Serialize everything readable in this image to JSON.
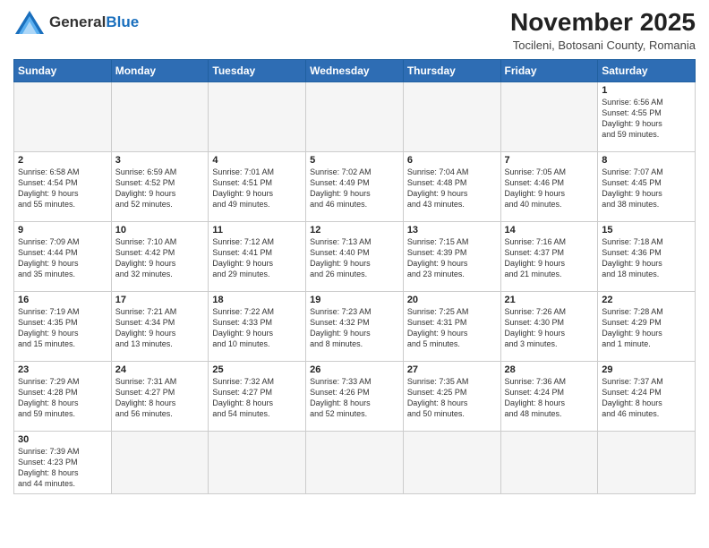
{
  "header": {
    "logo_general": "General",
    "logo_blue": "Blue",
    "month_title": "November 2025",
    "location": "Tocileni, Botosani County, Romania"
  },
  "weekdays": [
    "Sunday",
    "Monday",
    "Tuesday",
    "Wednesday",
    "Thursday",
    "Friday",
    "Saturday"
  ],
  "weeks": [
    [
      {
        "day": "",
        "info": ""
      },
      {
        "day": "",
        "info": ""
      },
      {
        "day": "",
        "info": ""
      },
      {
        "day": "",
        "info": ""
      },
      {
        "day": "",
        "info": ""
      },
      {
        "day": "",
        "info": ""
      },
      {
        "day": "1",
        "info": "Sunrise: 6:56 AM\nSunset: 4:55 PM\nDaylight: 9 hours\nand 59 minutes."
      }
    ],
    [
      {
        "day": "2",
        "info": "Sunrise: 6:58 AM\nSunset: 4:54 PM\nDaylight: 9 hours\nand 55 minutes."
      },
      {
        "day": "3",
        "info": "Sunrise: 6:59 AM\nSunset: 4:52 PM\nDaylight: 9 hours\nand 52 minutes."
      },
      {
        "day": "4",
        "info": "Sunrise: 7:01 AM\nSunset: 4:51 PM\nDaylight: 9 hours\nand 49 minutes."
      },
      {
        "day": "5",
        "info": "Sunrise: 7:02 AM\nSunset: 4:49 PM\nDaylight: 9 hours\nand 46 minutes."
      },
      {
        "day": "6",
        "info": "Sunrise: 7:04 AM\nSunset: 4:48 PM\nDaylight: 9 hours\nand 43 minutes."
      },
      {
        "day": "7",
        "info": "Sunrise: 7:05 AM\nSunset: 4:46 PM\nDaylight: 9 hours\nand 40 minutes."
      },
      {
        "day": "8",
        "info": "Sunrise: 7:07 AM\nSunset: 4:45 PM\nDaylight: 9 hours\nand 38 minutes."
      }
    ],
    [
      {
        "day": "9",
        "info": "Sunrise: 7:09 AM\nSunset: 4:44 PM\nDaylight: 9 hours\nand 35 minutes."
      },
      {
        "day": "10",
        "info": "Sunrise: 7:10 AM\nSunset: 4:42 PM\nDaylight: 9 hours\nand 32 minutes."
      },
      {
        "day": "11",
        "info": "Sunrise: 7:12 AM\nSunset: 4:41 PM\nDaylight: 9 hours\nand 29 minutes."
      },
      {
        "day": "12",
        "info": "Sunrise: 7:13 AM\nSunset: 4:40 PM\nDaylight: 9 hours\nand 26 minutes."
      },
      {
        "day": "13",
        "info": "Sunrise: 7:15 AM\nSunset: 4:39 PM\nDaylight: 9 hours\nand 23 minutes."
      },
      {
        "day": "14",
        "info": "Sunrise: 7:16 AM\nSunset: 4:37 PM\nDaylight: 9 hours\nand 21 minutes."
      },
      {
        "day": "15",
        "info": "Sunrise: 7:18 AM\nSunset: 4:36 PM\nDaylight: 9 hours\nand 18 minutes."
      }
    ],
    [
      {
        "day": "16",
        "info": "Sunrise: 7:19 AM\nSunset: 4:35 PM\nDaylight: 9 hours\nand 15 minutes."
      },
      {
        "day": "17",
        "info": "Sunrise: 7:21 AM\nSunset: 4:34 PM\nDaylight: 9 hours\nand 13 minutes."
      },
      {
        "day": "18",
        "info": "Sunrise: 7:22 AM\nSunset: 4:33 PM\nDaylight: 9 hours\nand 10 minutes."
      },
      {
        "day": "19",
        "info": "Sunrise: 7:23 AM\nSunset: 4:32 PM\nDaylight: 9 hours\nand 8 minutes."
      },
      {
        "day": "20",
        "info": "Sunrise: 7:25 AM\nSunset: 4:31 PM\nDaylight: 9 hours\nand 5 minutes."
      },
      {
        "day": "21",
        "info": "Sunrise: 7:26 AM\nSunset: 4:30 PM\nDaylight: 9 hours\nand 3 minutes."
      },
      {
        "day": "22",
        "info": "Sunrise: 7:28 AM\nSunset: 4:29 PM\nDaylight: 9 hours\nand 1 minute."
      }
    ],
    [
      {
        "day": "23",
        "info": "Sunrise: 7:29 AM\nSunset: 4:28 PM\nDaylight: 8 hours\nand 59 minutes."
      },
      {
        "day": "24",
        "info": "Sunrise: 7:31 AM\nSunset: 4:27 PM\nDaylight: 8 hours\nand 56 minutes."
      },
      {
        "day": "25",
        "info": "Sunrise: 7:32 AM\nSunset: 4:27 PM\nDaylight: 8 hours\nand 54 minutes."
      },
      {
        "day": "26",
        "info": "Sunrise: 7:33 AM\nSunset: 4:26 PM\nDaylight: 8 hours\nand 52 minutes."
      },
      {
        "day": "27",
        "info": "Sunrise: 7:35 AM\nSunset: 4:25 PM\nDaylight: 8 hours\nand 50 minutes."
      },
      {
        "day": "28",
        "info": "Sunrise: 7:36 AM\nSunset: 4:24 PM\nDaylight: 8 hours\nand 48 minutes."
      },
      {
        "day": "29",
        "info": "Sunrise: 7:37 AM\nSunset: 4:24 PM\nDaylight: 8 hours\nand 46 minutes."
      }
    ],
    [
      {
        "day": "30",
        "info": "Sunrise: 7:39 AM\nSunset: 4:23 PM\nDaylight: 8 hours\nand 44 minutes."
      },
      {
        "day": "",
        "info": ""
      },
      {
        "day": "",
        "info": ""
      },
      {
        "day": "",
        "info": ""
      },
      {
        "day": "",
        "info": ""
      },
      {
        "day": "",
        "info": ""
      },
      {
        "day": "",
        "info": ""
      }
    ]
  ]
}
